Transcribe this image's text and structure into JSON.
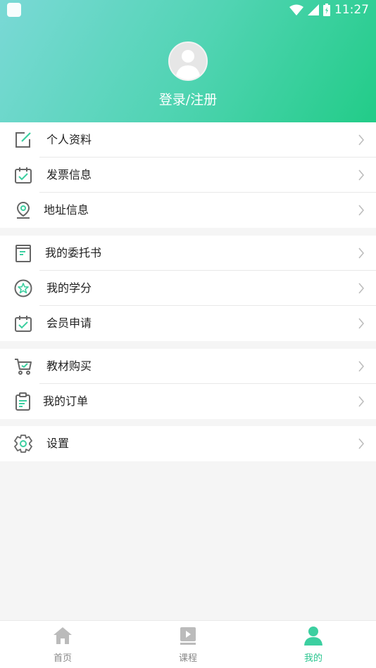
{
  "status_bar": {
    "time": "11:27"
  },
  "profile": {
    "login_label": "登录/注册"
  },
  "menu_groups": [
    {
      "items": [
        {
          "label": "个人资料",
          "icon": "edit-icon"
        },
        {
          "label": "发票信息",
          "icon": "calendar-check-icon"
        },
        {
          "label": "地址信息",
          "icon": "location-pin-icon"
        }
      ]
    },
    {
      "items": [
        {
          "label": "我的委托书",
          "icon": "document-icon"
        },
        {
          "label": "我的学分",
          "icon": "star-badge-icon"
        },
        {
          "label": "会员申请",
          "icon": "calendar-check-icon"
        }
      ]
    },
    {
      "items": [
        {
          "label": "教材购买",
          "icon": "cart-icon"
        },
        {
          "label": "我的订单",
          "icon": "clipboard-icon"
        }
      ]
    },
    {
      "items": [
        {
          "label": "设置",
          "icon": "gear-icon"
        }
      ]
    }
  ],
  "tabbar": {
    "tabs": [
      {
        "label": "首页",
        "icon": "home-icon",
        "active": false
      },
      {
        "label": "课程",
        "icon": "course-video-icon",
        "active": false
      },
      {
        "label": "我的",
        "icon": "person-icon",
        "active": true
      }
    ]
  },
  "colors": {
    "accent": "#2ac58f",
    "icon_gray": "#777777",
    "icon_accent": "#3ccfa0"
  }
}
